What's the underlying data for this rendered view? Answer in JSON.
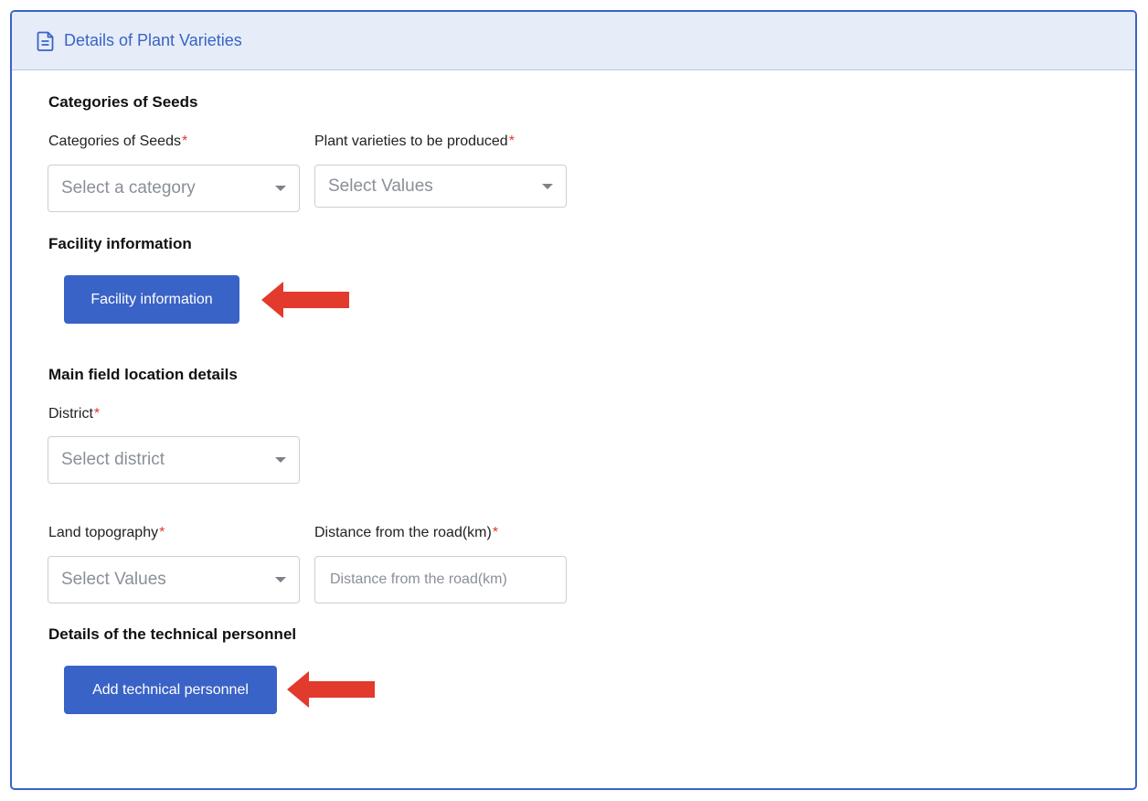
{
  "colors": {
    "primary": "#3a63c7",
    "header_bg": "#e6edf8",
    "required": "#e03a2f",
    "arrow": "#e23a2c"
  },
  "panel": {
    "title": "Details of Plant Varieties",
    "icon": "document-icon"
  },
  "seeds": {
    "section_title": "Categories of Seeds",
    "category": {
      "label": "Categories of Seeds",
      "required": "*",
      "placeholder": "Select a category"
    },
    "varieties": {
      "label": "Plant varieties to be produced",
      "required": "*",
      "placeholder": "Select Values"
    }
  },
  "facility": {
    "section_title": "Facility information",
    "button_label": "Facility information"
  },
  "location": {
    "section_title": "Main field location details",
    "district": {
      "label": "District",
      "required": "*",
      "placeholder": "Select district"
    },
    "topography": {
      "label": "Land topography",
      "required": "*",
      "placeholder": "Select Values"
    },
    "distance": {
      "label": "Distance from the road(km)",
      "required": "*",
      "placeholder": "Distance from the road(km)"
    }
  },
  "personnel": {
    "section_title": "Details of the technical personnel",
    "button_label": "Add technical personnel"
  }
}
